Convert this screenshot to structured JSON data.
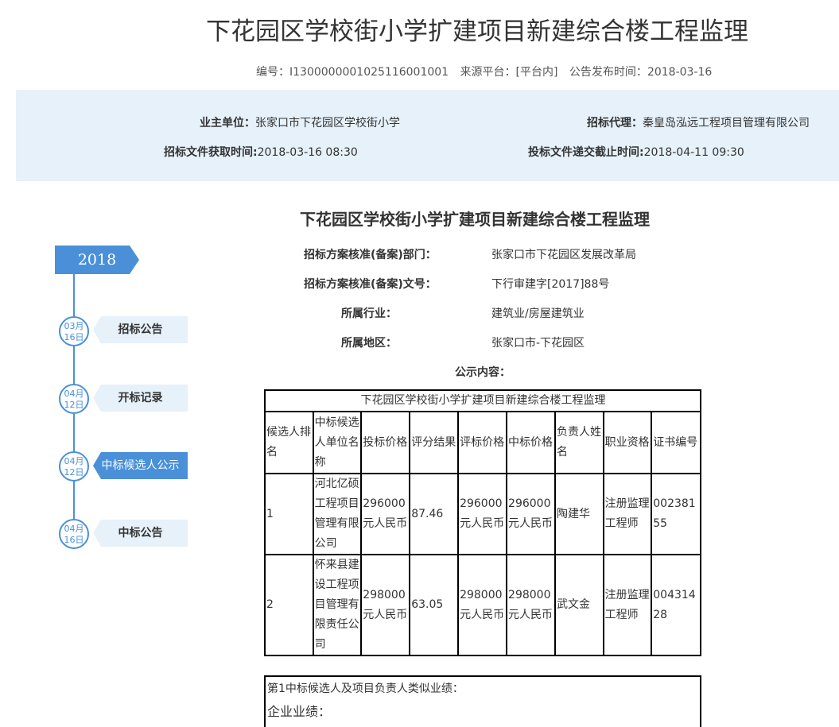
{
  "header": {
    "title": "下花园区学校街小学扩建项目新建综合楼工程监理",
    "code_label": "编号：",
    "code_value": "I1300000001025116001001",
    "source_label": "来源平台：",
    "source_value": "[平台内]",
    "publish_label": "公告发布时间：",
    "publish_value": "2018-03-16"
  },
  "info": {
    "owner_label": "业主单位：",
    "owner_value": "张家口市下花园区学校街小学",
    "agent_label": "招标代理：",
    "agent_value": "秦皇岛泓远工程项目管理有限公司",
    "doc_time_label": "招标文件获取时间:",
    "doc_time_value": "2018-03-16 08:30",
    "deadline_label": "投标文件递交截止时间:",
    "deadline_value": "2018-04-11 09:30"
  },
  "timeline": {
    "year": "2018",
    "steps": [
      {
        "date_month": "03月",
        "date_day": "16日",
        "label": "招标公告"
      },
      {
        "date_month": "04月",
        "date_day": "12日",
        "label": "开标记录"
      },
      {
        "date_month": "04月",
        "date_day": "12日",
        "label": "中标候选人公示"
      },
      {
        "date_month": "04月",
        "date_day": "16日",
        "label": "中标公告"
      }
    ]
  },
  "detail": {
    "section_title": "下花园区学校街小学扩建项目新建综合楼工程监理",
    "fields": [
      {
        "label": "招标方案核准(备案)部门：",
        "value": "张家口市下花园区发展改革局"
      },
      {
        "label": "招标方案核准(备案)文号：",
        "value": "下行审建字[2017]88号"
      },
      {
        "label": "所属行业：",
        "value": "建筑业/房屋建筑业"
      },
      {
        "label": "所属地区：",
        "value": "张家口市-下花园区"
      }
    ],
    "content_label": "公示内容："
  },
  "table": {
    "caption": "下花园区学校街小学扩建项目新建综合楼工程监理",
    "headers": [
      "候选人排名",
      "中标候选人单位名称",
      "投标价格",
      "评分结果",
      "评标价格",
      "中标价格",
      "负责人姓名",
      "职业资格",
      "证书编号"
    ],
    "rows": [
      [
        "1",
        "河北亿硕工程项目管理有限公司",
        "296000元人民币",
        "87.46",
        "296000元人民币",
        "296000元人民币",
        "陶建华",
        "注册监理工程师",
        "00238155"
      ],
      [
        "2",
        "怀来县建设工程项目管理有限责任公司",
        "298000元人民币",
        "63.05",
        "298000元人民币",
        "298000元人民币",
        "武文金",
        "注册监理工程师",
        "00431428"
      ]
    ]
  },
  "performance": {
    "line1": "第1中标候选人及项目负责人类似业绩：",
    "line2": "企业业绩："
  },
  "colors": {
    "accent": "#4a90d9",
    "band": "#e6f1fa"
  }
}
